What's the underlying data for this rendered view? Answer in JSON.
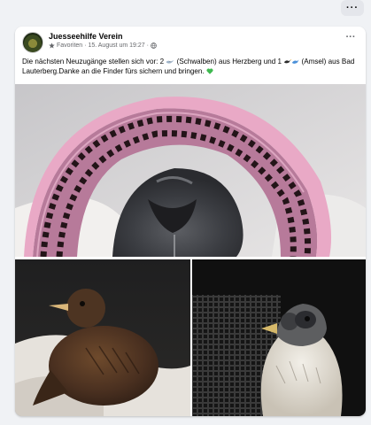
{
  "top": {
    "more_label": "···"
  },
  "post": {
    "author": "Juesseehilfe Verein",
    "audience": "Favoriten",
    "date": "· 15. August um 19:27 ·",
    "menu_label": "···",
    "text_part1": "Die nächsten Neuzugänge stellen sich vor: 2",
    "text_part2": "(Schwalben) aus Herzberg und 1",
    "text_part3": "(Amsel) aus Bad Lauterberg.Danke an die Finder fürs sichern und bringen.",
    "icons": [
      "star-icon",
      "globe-icon",
      "swallow-emoji-icon",
      "blackbird-emoji-icon",
      "green-heart-icon"
    ],
    "accent_color": "#1877f2",
    "heart_color": "#3fb950"
  },
  "photos": [
    {
      "subject": "swallow chick in pink crocheted nest"
    },
    {
      "subject": "young blackbird on white blanket"
    },
    {
      "subject": "swallow chick in carrier"
    }
  ]
}
